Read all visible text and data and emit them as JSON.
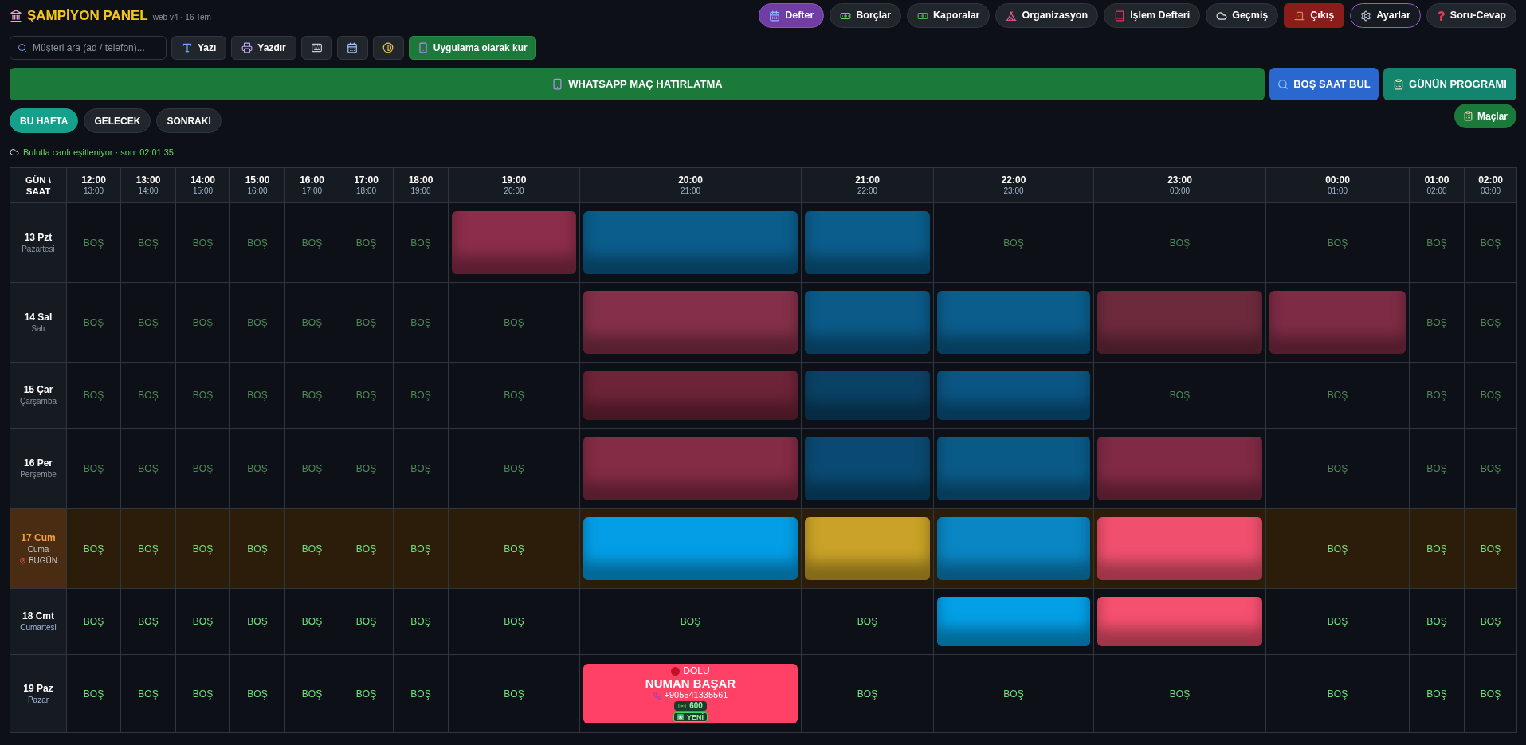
{
  "header": {
    "title": "ŞAMPİYON PANEL",
    "subtitle": "web v4 · 16 Tem"
  },
  "nav": [
    {
      "label": "Defter",
      "kind": "normal",
      "selected": true
    },
    {
      "label": "Borçlar",
      "kind": "normal",
      "selected": false
    },
    {
      "label": "Kaporalar",
      "kind": "normal",
      "selected": false
    },
    {
      "label": "Organizasyon",
      "kind": "normal",
      "selected": false
    },
    {
      "label": "İşlem Defteri",
      "kind": "normal",
      "selected": false
    },
    {
      "label": "Geçmiş",
      "kind": "normal",
      "selected": false
    },
    {
      "label": "Çıkış",
      "kind": "danger",
      "selected": false
    },
    {
      "label": "Ayarlar",
      "kind": "outlined",
      "selected": false
    },
    {
      "label": "Soru-Cevap",
      "kind": "normal",
      "selected": false
    }
  ],
  "toolbar": {
    "search": {
      "placeholder": "Müşteri ara (ad / telefon)..."
    },
    "buttons": [
      {
        "kind": "labeled",
        "label": "Yazı"
      },
      {
        "kind": "labeled",
        "label": "Yazdır"
      },
      {
        "kind": "icon"
      },
      {
        "kind": "icon"
      },
      {
        "kind": "icon"
      },
      {
        "kind": "primary",
        "label": "Uygulama olarak kur"
      }
    ]
  },
  "actions": [
    {
      "kind": "whatsapp",
      "label": "WHATSAPP MAÇ HATIRLATMA"
    },
    {
      "kind": "find",
      "label": "BOŞ SAAT BUL"
    },
    {
      "kind": "program",
      "label": "GÜNÜN PROGRAMI"
    }
  ],
  "week_tabs": [
    {
      "label": "BU HAFTA",
      "selected": true
    },
    {
      "label": "GELECEK",
      "selected": false
    },
    {
      "label": "SONRAKİ",
      "selected": false
    }
  ],
  "matches_button": {
    "label": "Maçlar"
  },
  "sync_status": "Bulutla canlı eşitleniyor · son: 02:01:35",
  "schedule": {
    "corner": "GÜN \\ SAAT",
    "hours": [
      {
        "start": "12:00",
        "end": "13:00"
      },
      {
        "start": "13:00",
        "end": "14:00"
      },
      {
        "start": "14:00",
        "end": "15:00"
      },
      {
        "start": "15:00",
        "end": "16:00"
      },
      {
        "start": "16:00",
        "end": "17:00"
      },
      {
        "start": "17:00",
        "end": "18:00"
      },
      {
        "start": "18:00",
        "end": "19:00"
      },
      {
        "start": "19:00",
        "end": "20:00"
      },
      {
        "start": "20:00",
        "end": "21:00"
      },
      {
        "start": "21:00",
        "end": "22:00"
      },
      {
        "start": "22:00",
        "end": "23:00"
      },
      {
        "start": "23:00",
        "end": "00:00"
      },
      {
        "start": "00:00",
        "end": "01:00"
      },
      {
        "start": "01:00",
        "end": "02:00"
      },
      {
        "start": "02:00",
        "end": "03:00"
      }
    ],
    "days": [
      {
        "date": "13 Pzt",
        "name": "Pazartesi",
        "past": true,
        "today": false,
        "cells": [
          {
            "kind": "free",
            "text": "BOŞ"
          },
          {
            "kind": "free",
            "text": "BOŞ"
          },
          {
            "kind": "free",
            "text": "BOŞ"
          },
          {
            "kind": "free",
            "text": "BOŞ"
          },
          {
            "kind": "free",
            "text": "BOŞ"
          },
          {
            "kind": "free",
            "text": "BOŞ"
          },
          {
            "kind": "free",
            "text": "BOŞ"
          },
          {
            "kind": "hidden",
            "color": "#8b2d4b"
          },
          {
            "kind": "hidden",
            "color": "#0b5d8c"
          },
          {
            "kind": "hidden",
            "color": "#0b5d8c"
          },
          {
            "kind": "free",
            "text": "BOŞ"
          },
          {
            "kind": "free",
            "text": "BOŞ"
          },
          {
            "kind": "free",
            "text": "BOŞ"
          },
          {
            "kind": "free",
            "text": "BOŞ"
          },
          {
            "kind": "free",
            "text": "BOŞ"
          }
        ]
      },
      {
        "date": "14 Sal",
        "name": "Salı",
        "past": true,
        "today": false,
        "cells": [
          {
            "kind": "free",
            "text": "BOŞ"
          },
          {
            "kind": "free",
            "text": "BOŞ"
          },
          {
            "kind": "free",
            "text": "BOŞ"
          },
          {
            "kind": "free",
            "text": "BOŞ"
          },
          {
            "kind": "free",
            "text": "BOŞ"
          },
          {
            "kind": "free",
            "text": "BOŞ"
          },
          {
            "kind": "free",
            "text": "BOŞ"
          },
          {
            "kind": "free",
            "text": "BOŞ"
          },
          {
            "kind": "hidden",
            "color": "#84304a"
          },
          {
            "kind": "hidden",
            "color": "#0b5a88"
          },
          {
            "kind": "hidden",
            "color": "#0b5d8c"
          },
          {
            "kind": "hidden",
            "color": "#6d2a3d"
          },
          {
            "kind": "hidden",
            "color": "#7e2c45"
          },
          {
            "kind": "free",
            "text": "BOŞ"
          },
          {
            "kind": "free",
            "text": "BOŞ"
          }
        ]
      },
      {
        "date": "15 Çar",
        "name": "Çarşamba",
        "past": true,
        "today": false,
        "cells": [
          {
            "kind": "free",
            "text": "BOŞ"
          },
          {
            "kind": "free",
            "text": "BOŞ"
          },
          {
            "kind": "free",
            "text": "BOŞ"
          },
          {
            "kind": "free",
            "text": "BOŞ"
          },
          {
            "kind": "free",
            "text": "BOŞ"
          },
          {
            "kind": "free",
            "text": "BOŞ"
          },
          {
            "kind": "free",
            "text": "BOŞ"
          },
          {
            "kind": "free",
            "text": "BOŞ"
          },
          {
            "kind": "hidden",
            "color": "#6e2438"
          },
          {
            "kind": "hidden",
            "color": "#0a4266"
          },
          {
            "kind": "hidden",
            "color": "#0a5584"
          },
          {
            "kind": "free",
            "text": "BOŞ"
          },
          {
            "kind": "free",
            "text": "BOŞ"
          },
          {
            "kind": "free",
            "text": "BOŞ"
          },
          {
            "kind": "free",
            "text": "BOŞ"
          }
        ]
      },
      {
        "date": "16 Per",
        "name": "Perşembe",
        "past": true,
        "today": false,
        "cells": [
          {
            "kind": "free",
            "text": "BOŞ"
          },
          {
            "kind": "free",
            "text": "BOŞ"
          },
          {
            "kind": "free",
            "text": "BOŞ"
          },
          {
            "kind": "free",
            "text": "BOŞ"
          },
          {
            "kind": "free",
            "text": "BOŞ"
          },
          {
            "kind": "free",
            "text": "BOŞ"
          },
          {
            "kind": "free",
            "text": "BOŞ"
          },
          {
            "kind": "free",
            "text": "BOŞ"
          },
          {
            "kind": "hidden",
            "color": "#842b45"
          },
          {
            "kind": "hidden",
            "color": "#0a4a72"
          },
          {
            "kind": "hidden",
            "color": "#0a5a88"
          },
          {
            "kind": "hidden",
            "color": "#812a45"
          },
          {
            "kind": "free",
            "text": "BOŞ"
          },
          {
            "kind": "free",
            "text": "BOŞ"
          },
          {
            "kind": "free",
            "text": "BOŞ"
          }
        ]
      },
      {
        "date": "17 Cum",
        "name": "Cuma",
        "past": false,
        "today": true,
        "badge": "BUGÜN",
        "cells": [
          {
            "kind": "free",
            "text": "BOŞ"
          },
          {
            "kind": "free",
            "text": "BOŞ"
          },
          {
            "kind": "free",
            "text": "BOŞ"
          },
          {
            "kind": "free",
            "text": "BOŞ"
          },
          {
            "kind": "free",
            "text": "BOŞ"
          },
          {
            "kind": "free",
            "text": "BOŞ"
          },
          {
            "kind": "free",
            "text": "BOŞ"
          },
          {
            "kind": "free",
            "text": "BOŞ"
          },
          {
            "kind": "hidden",
            "color": "#049ee6"
          },
          {
            "kind": "hidden",
            "color": "#c9a227"
          },
          {
            "kind": "hidden",
            "color": "#0a86c4"
          },
          {
            "kind": "hidden",
            "color": "#f0506e"
          },
          {
            "kind": "free",
            "text": "BOŞ"
          },
          {
            "kind": "free",
            "text": "BOŞ"
          },
          {
            "kind": "free",
            "text": "BOŞ"
          }
        ]
      },
      {
        "date": "18 Cmt",
        "name": "Cumartesi",
        "past": false,
        "today": false,
        "cells": [
          {
            "kind": "free",
            "text": "BOŞ"
          },
          {
            "kind": "free",
            "text": "BOŞ"
          },
          {
            "kind": "free",
            "text": "BOŞ"
          },
          {
            "kind": "free",
            "text": "BOŞ"
          },
          {
            "kind": "free",
            "text": "BOŞ"
          },
          {
            "kind": "free",
            "text": "BOŞ"
          },
          {
            "kind": "free",
            "text": "BOŞ"
          },
          {
            "kind": "free",
            "text": "BOŞ"
          },
          {
            "kind": "free",
            "text": "BOŞ"
          },
          {
            "kind": "free",
            "text": "BOŞ"
          },
          {
            "kind": "hidden",
            "color": "#03a0e6"
          },
          {
            "kind": "hidden",
            "color": "#f5506f"
          },
          {
            "kind": "free",
            "text": "BOŞ"
          },
          {
            "kind": "free",
            "text": "BOŞ"
          },
          {
            "kind": "free",
            "text": "BOŞ"
          }
        ]
      },
      {
        "date": "19 Paz",
        "name": "Pazar",
        "past": false,
        "today": false,
        "cells": [
          {
            "kind": "free",
            "text": "BOŞ"
          },
          {
            "kind": "free",
            "text": "BOŞ"
          },
          {
            "kind": "free",
            "text": "BOŞ"
          },
          {
            "kind": "free",
            "text": "BOŞ"
          },
          {
            "kind": "free",
            "text": "BOŞ"
          },
          {
            "kind": "free",
            "text": "BOŞ"
          },
          {
            "kind": "free",
            "text": "BOŞ"
          },
          {
            "kind": "free",
            "text": "BOŞ"
          },
          {
            "kind": "booked",
            "color": "#ff4166",
            "status": "DOLU",
            "name": "NUMAN BAŞAR",
            "phone": "+905541335561",
            "amount": "600",
            "tag": "YENİ"
          },
          {
            "kind": "free",
            "text": "BOŞ"
          },
          {
            "kind": "free",
            "text": "BOŞ"
          },
          {
            "kind": "free",
            "text": "BOŞ"
          },
          {
            "kind": "free",
            "text": "BOŞ"
          },
          {
            "kind": "free",
            "text": "BOŞ"
          },
          {
            "kind": "free",
            "text": "BOŞ"
          }
        ]
      }
    ]
  }
}
